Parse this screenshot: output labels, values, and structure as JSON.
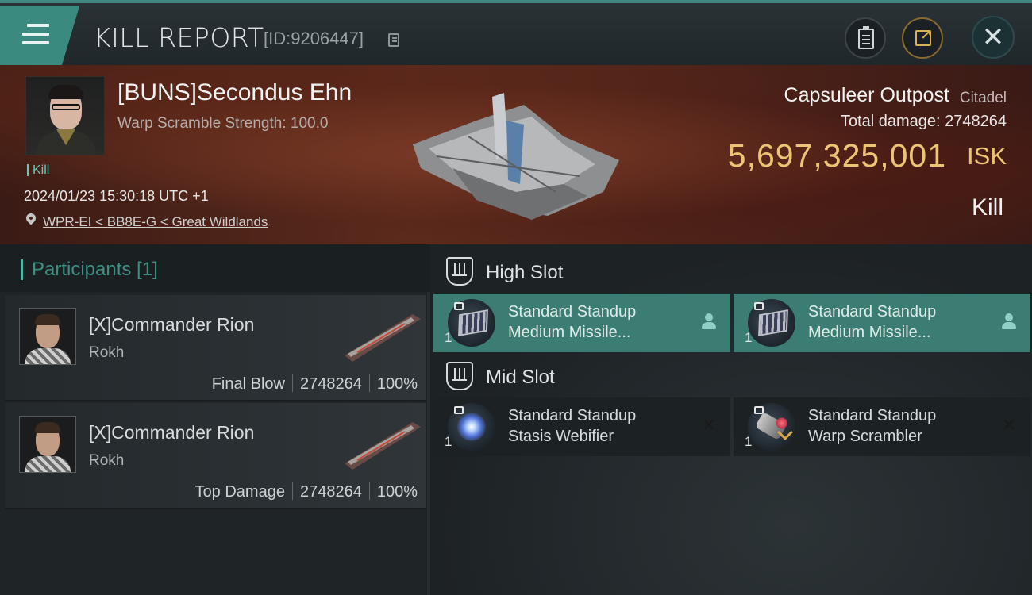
{
  "header": {
    "title": "KILL REPORT",
    "id_text": "[ID:9206447]"
  },
  "victim": {
    "name": "[BUNS]Secondus Ehn",
    "warp_scramble": "Warp Scramble Strength: 100.0",
    "kill_tag": "Kill",
    "datetime": "2024/01/23 15:30:18 UTC +1",
    "location": "WPR-EI < BB8E-G < Great Wildlands"
  },
  "target": {
    "name": "Capsuleer Outpost",
    "type": "Citadel",
    "total_damage": "Total damage:  2748264",
    "isk_value": "5,697,325,001",
    "isk_unit": "ISK",
    "result": "Kill"
  },
  "participants": {
    "header": "Participants [1]",
    "rows": [
      {
        "name": "[X]Commander Rion",
        "ship": "Rokh",
        "role": "Final Blow",
        "damage": "2748264",
        "percent": "100%"
      },
      {
        "name": "[X]Commander Rion",
        "ship": "Rokh",
        "role": "Top Damage",
        "damage": "2748264",
        "percent": "100%"
      }
    ]
  },
  "fitting": {
    "high_slot_label": "High Slot",
    "mid_slot_label": "Mid Slot",
    "modules": [
      {
        "line1": "Standard Standup",
        "line2": "Medium Missile...",
        "qty": "1",
        "status": "person-icon"
      },
      {
        "line1": "Standard Standup",
        "line2": "Medium Missile...",
        "qty": "1",
        "status": "person-icon"
      },
      {
        "line1": "Standard Standup",
        "line2": "Stasis Webifier",
        "qty": "1",
        "status": "close-icon"
      },
      {
        "line1": "Standard Standup",
        "line2": "Warp Scrambler",
        "qty": "1",
        "status": "close-icon"
      }
    ]
  },
  "colors": {
    "accent_teal": "#3a8a80",
    "isk_gold": "#ecc474",
    "module_active": "#3b7d72"
  }
}
